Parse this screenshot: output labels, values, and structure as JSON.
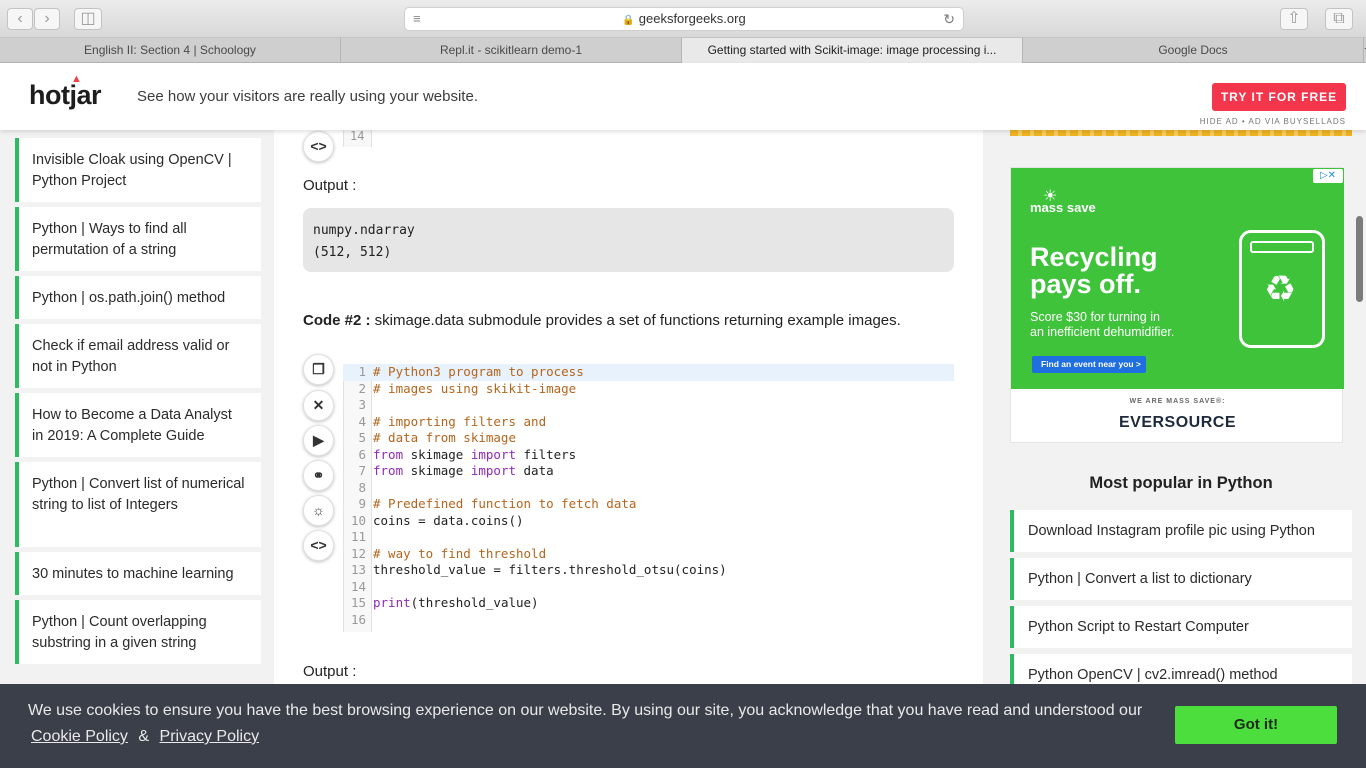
{
  "browser": {
    "url": "geeksforgeeks.org",
    "tabs": [
      {
        "label": "English II: Section 4 | Schoology"
      },
      {
        "label": "Repl.it - scikitlearn demo-1"
      },
      {
        "label": "Getting started with Scikit-image: image processing i..."
      },
      {
        "label": "Google Docs"
      }
    ]
  },
  "ad_bar": {
    "logo": "hotjar",
    "tagline": "See how your visitors are really using your website.",
    "cta": "TRY IT FOR FREE",
    "hide_ad": "HIDE AD • AD VIA BUYSELLADS"
  },
  "sidebar": {
    "items": [
      {
        "label": "Invisible Cloak using OpenCV | Python Project"
      },
      {
        "label": "Python | Ways to find all permutation of a string"
      },
      {
        "label": "Python | os.path.join() method"
      },
      {
        "label": "Check if email address valid or not in Python"
      },
      {
        "label": "How to Become a Data Analyst in 2019: A Complete Guide"
      },
      {
        "label": "Python | Convert list of numerical string to list of Integers"
      },
      {
        "label": "30 minutes to machine learning"
      },
      {
        "label": "Python | Count overlapping substring in a given string"
      }
    ]
  },
  "main": {
    "prev_last_line": "14",
    "output_label_1": "Output :",
    "output_lines": [
      "numpy.ndarray",
      "(512, 512)"
    ],
    "code2_title_bold": "Code #2 :",
    "code2_title_rest": " skimage.data submodule provides a set of functions returning example images.",
    "code_lines": [
      {
        "n": "1",
        "parts": [
          {
            "t": "# Python3 program to process",
            "c": "cmt"
          }
        ]
      },
      {
        "n": "2",
        "parts": [
          {
            "t": "# images using skikit-image",
            "c": "cmt"
          }
        ]
      },
      {
        "n": "3",
        "parts": [
          {
            "t": "",
            "c": ""
          }
        ]
      },
      {
        "n": "4",
        "parts": [
          {
            "t": "# importing filters and",
            "c": "cmt"
          }
        ]
      },
      {
        "n": "5",
        "parts": [
          {
            "t": "# data from skimage",
            "c": "cmt"
          }
        ]
      },
      {
        "n": "6",
        "parts": [
          {
            "t": "from",
            "c": "kw"
          },
          {
            "t": " skimage ",
            "c": ""
          },
          {
            "t": "import",
            "c": "kw"
          },
          {
            "t": " filters",
            "c": ""
          }
        ]
      },
      {
        "n": "7",
        "parts": [
          {
            "t": "from",
            "c": "kw"
          },
          {
            "t": " skimage ",
            "c": ""
          },
          {
            "t": "import",
            "c": "kw"
          },
          {
            "t": " data",
            "c": ""
          }
        ]
      },
      {
        "n": "8",
        "parts": [
          {
            "t": "",
            "c": ""
          }
        ]
      },
      {
        "n": "9",
        "parts": [
          {
            "t": "# Predefined function to fetch data",
            "c": "cmt"
          }
        ]
      },
      {
        "n": "10",
        "parts": [
          {
            "t": "coins = data.coins()",
            "c": ""
          }
        ]
      },
      {
        "n": "11",
        "parts": [
          {
            "t": "",
            "c": ""
          }
        ]
      },
      {
        "n": "12",
        "parts": [
          {
            "t": "# way to find threshold",
            "c": "cmt"
          }
        ]
      },
      {
        "n": "13",
        "parts": [
          {
            "t": "threshold_value = filters.threshold_otsu(coins)",
            "c": ""
          }
        ]
      },
      {
        "n": "14",
        "parts": [
          {
            "t": "",
            "c": ""
          }
        ]
      },
      {
        "n": "15",
        "parts": [
          {
            "t": "print",
            "c": "kw"
          },
          {
            "t": "(threshold_value)",
            "c": ""
          }
        ]
      },
      {
        "n": "16",
        "parts": [
          {
            "t": "",
            "c": ""
          }
        ]
      }
    ],
    "output_label_2": "Output :"
  },
  "right": {
    "ad": {
      "logo": "mass save",
      "headline_1": "Recycling",
      "headline_2": "pays off.",
      "sub_1": "Score $30 for turning in",
      "sub_2": "an inefficient dehumidifier.",
      "button": "Find an event near you >",
      "tag": "WE ARE MASS SAVE®:",
      "brand": "EVERSOURCE"
    },
    "popular_title": "Most popular in Python",
    "popular": [
      {
        "label": "Download Instagram profile pic using Python"
      },
      {
        "label": "Python | Convert a list to dictionary"
      },
      {
        "label": "Python Script to Restart Computer"
      },
      {
        "label": "Python OpenCV | cv2.imread() method"
      }
    ]
  },
  "cookie": {
    "text": "We use cookies to ensure you have the best browsing experience on our website. By using our site, you acknowledge that you have read and understood our",
    "policy": "Cookie Policy",
    "amp": "&",
    "privacy": "Privacy Policy",
    "button": "Got it!"
  },
  "colors": {
    "accent_green": "#2fbb62",
    "cta_red": "#f4364c",
    "cookie_bg": "#3b3f4a",
    "got_it": "#4cde3c",
    "ad_green": "#3ec33b"
  }
}
